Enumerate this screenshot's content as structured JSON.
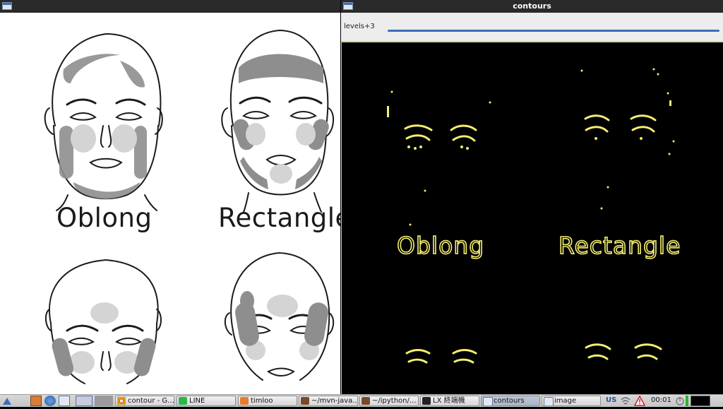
{
  "left_window": {
    "face_labels": [
      "Oblong",
      "Rectangle"
    ]
  },
  "right_window": {
    "title": "contours",
    "trackbar_label": "levels+3",
    "contour_labels": [
      "Oblong",
      "Rectangle"
    ]
  },
  "taskbar": {
    "tasks": [
      {
        "label": "contour - G...",
        "icon": "chrome-icon"
      },
      {
        "label": "LINE",
        "icon": "line-icon"
      },
      {
        "label": "timloo",
        "icon": "folder-icon"
      },
      {
        "label": "~/mvn-java...",
        "icon": "terminal-icon"
      },
      {
        "label": "~/ipython/...",
        "icon": "terminal-icon"
      },
      {
        "label": "LX 終端機",
        "icon": "terminal-icon"
      },
      {
        "label": "contours",
        "icon": "window-icon"
      },
      {
        "label": "image",
        "icon": "window-icon"
      }
    ],
    "keyboard_layout": "US",
    "clock": "00:01",
    "colors": {
      "accent": "#3a6ebe",
      "contour": "#f4ee6e"
    }
  }
}
